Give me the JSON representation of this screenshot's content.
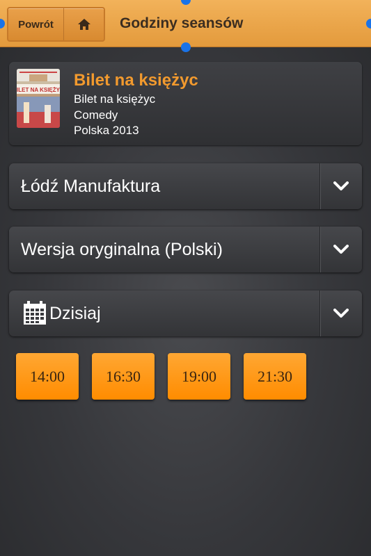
{
  "header": {
    "back_label": "Powrót",
    "title": "Godziny seansów"
  },
  "movie": {
    "title": "Bilet na księżyc",
    "original_title": "Bilet na księżyc",
    "genre": "Comedy",
    "production": "Polska 2013",
    "poster_text": "BILET NA KSIĘŻYC"
  },
  "selectors": {
    "cinema": "Łódź Manufaktura",
    "version": "Wersja oryginalna (Polski)",
    "date": "Dzisiaj"
  },
  "showtimes": [
    "14:00",
    "16:30",
    "19:00",
    "21:30"
  ],
  "colors": {
    "accent": "#f29a2e",
    "header": "#e39a3c",
    "showtime_button": "#ff8c00",
    "selection_handle": "#1a73e8"
  }
}
